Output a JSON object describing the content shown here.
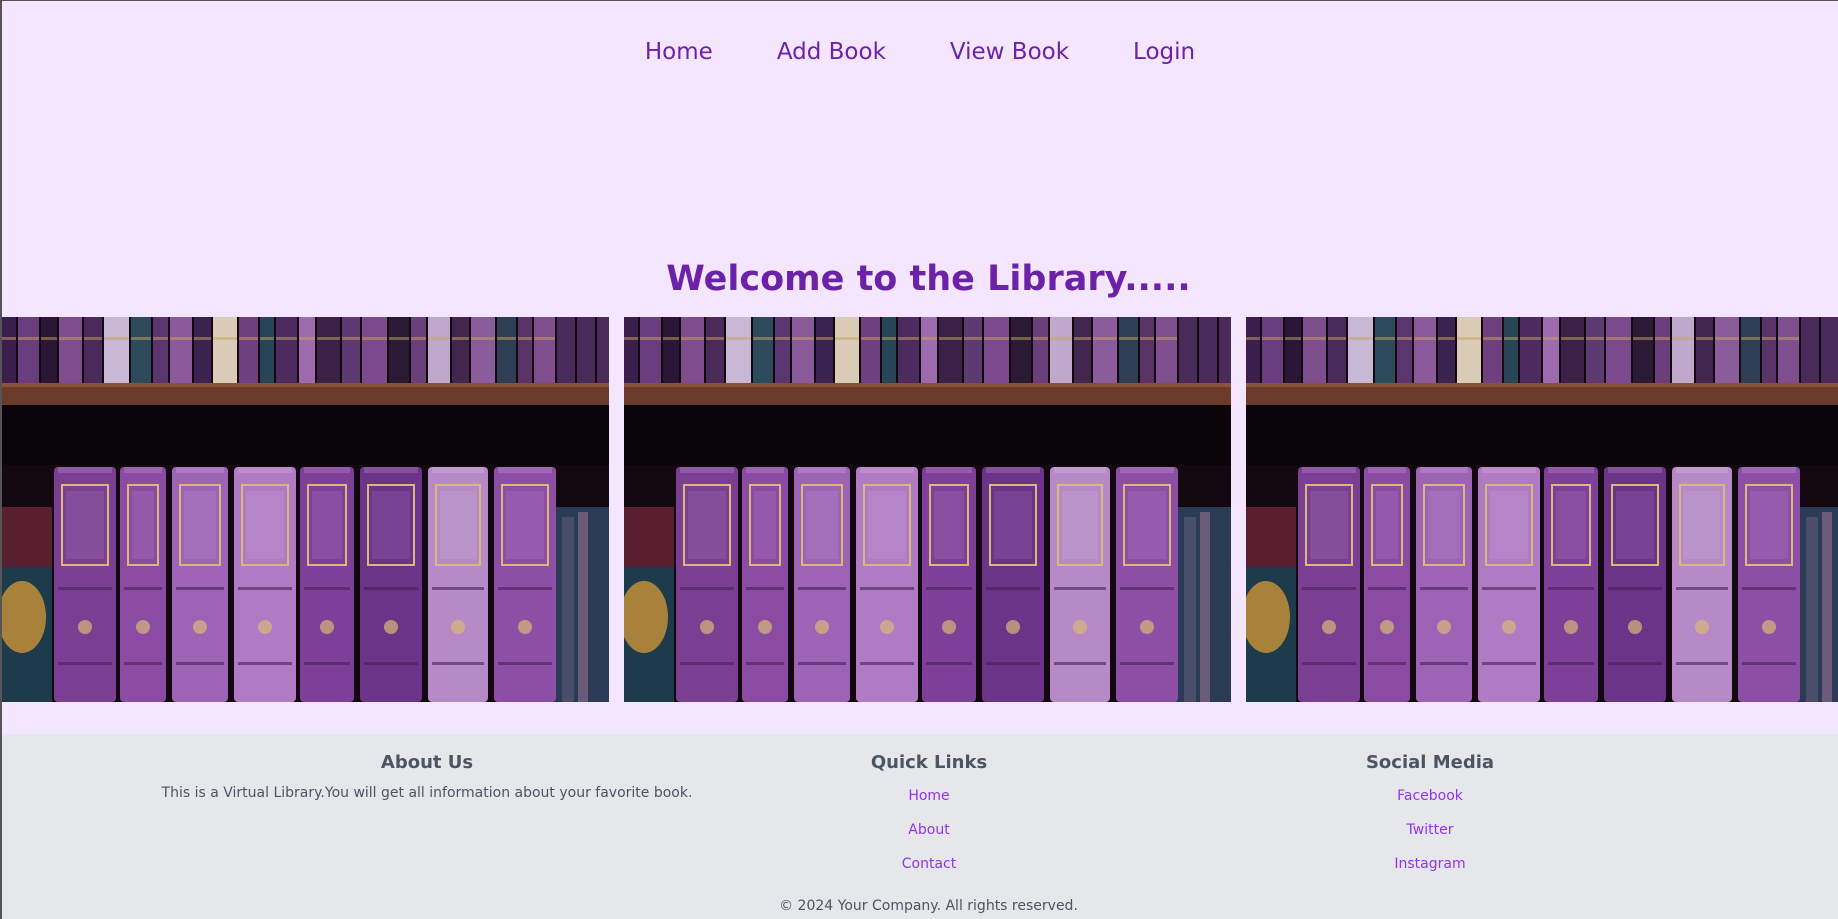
{
  "nav": {
    "items": [
      {
        "label": "Home"
      },
      {
        "label": "Add Book"
      },
      {
        "label": "View Book"
      },
      {
        "label": "Login"
      }
    ]
  },
  "hero": {
    "title": "Welcome to the Library....."
  },
  "footer": {
    "about": {
      "heading": "About Us",
      "text": "This is a Virtual Library.You will get all information about your favorite book."
    },
    "quick_links": {
      "heading": "Quick Links",
      "links": [
        "Home",
        "About",
        "Contact"
      ]
    },
    "social": {
      "heading": "Social Media",
      "links": [
        "Facebook",
        "Twitter",
        "Instagram"
      ]
    },
    "copyright": "© 2024 Your Company. All rights reserved."
  },
  "colors": {
    "background": "#f5e6ff",
    "accent": "#6b21a8",
    "link": "#9333ea",
    "footer_bg": "#e6e7ea",
    "footer_text": "#4b5563"
  }
}
